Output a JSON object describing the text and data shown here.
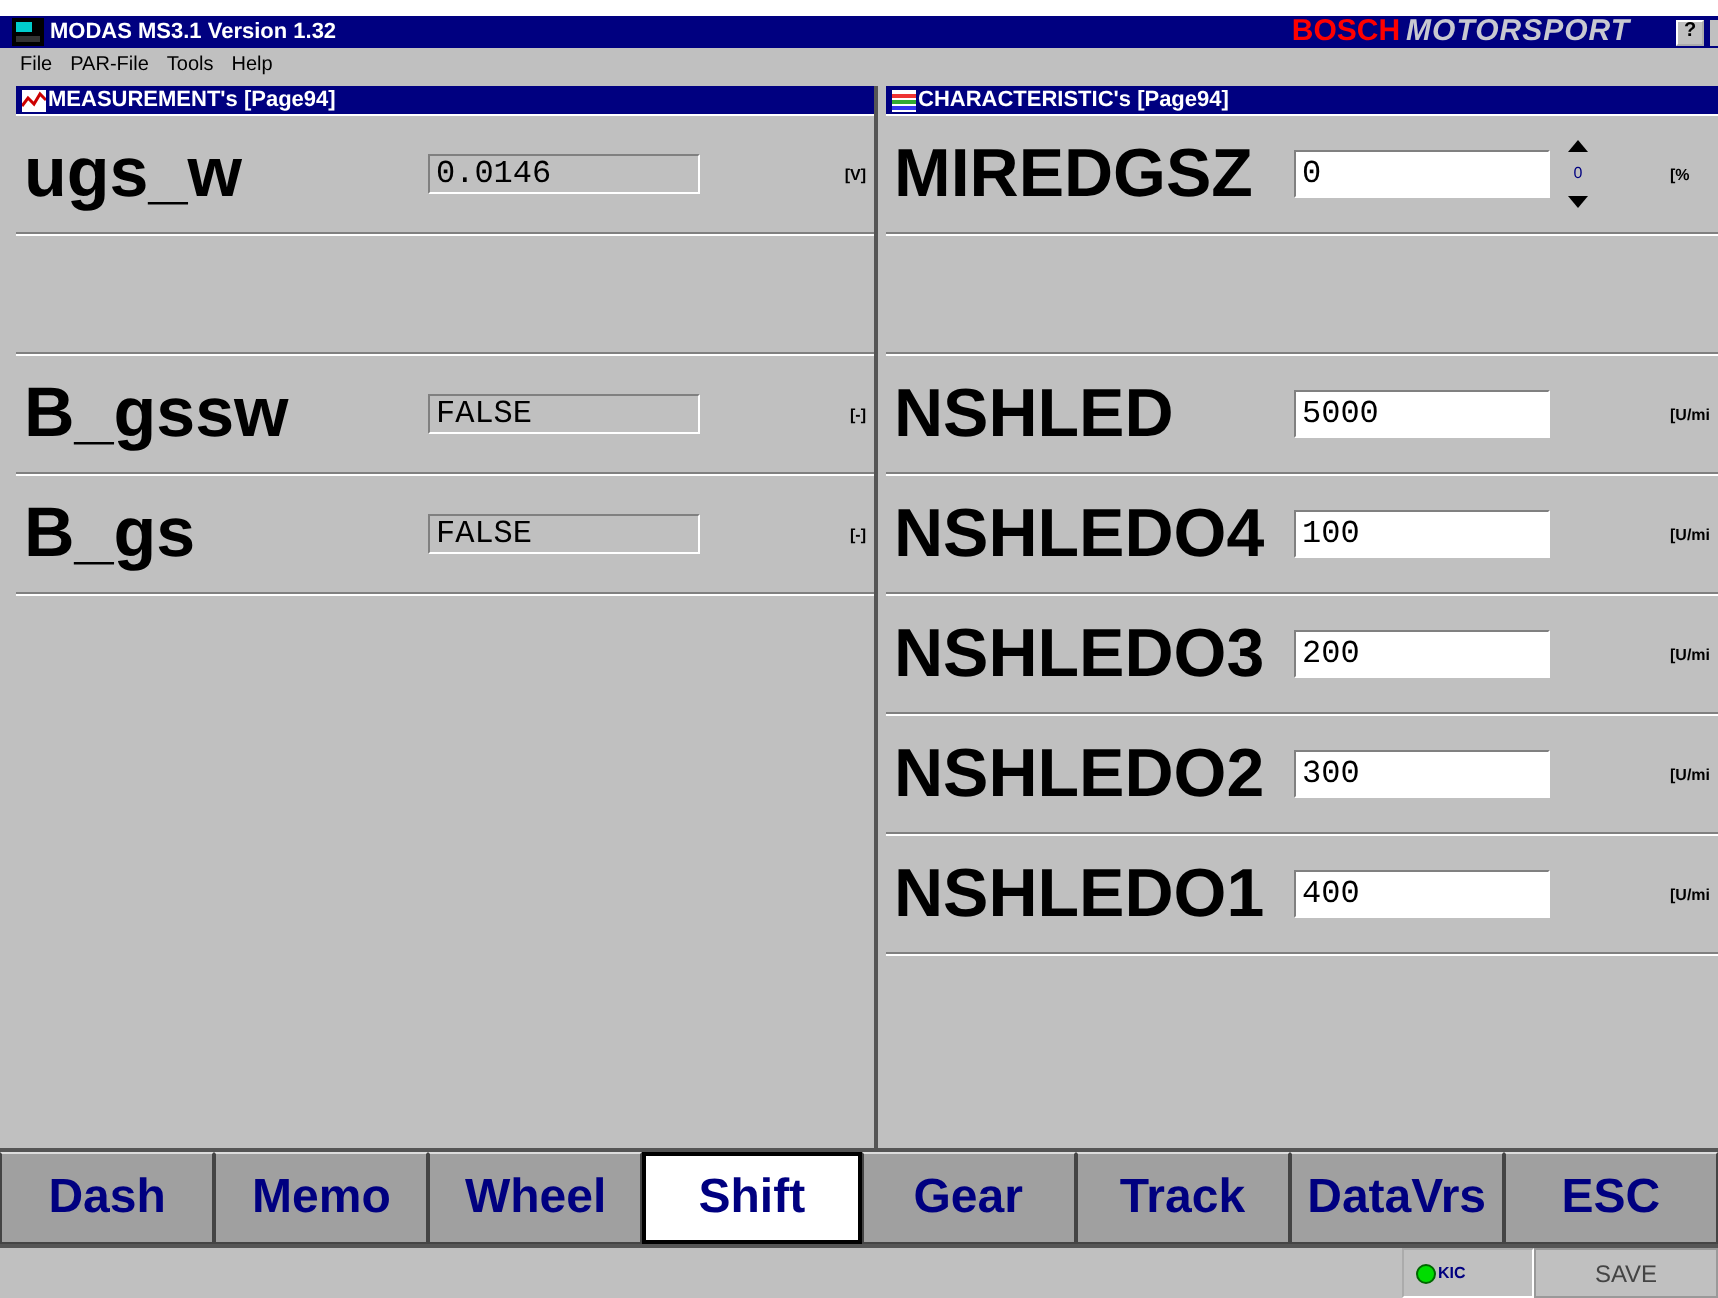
{
  "window": {
    "title": "MODAS MS3.1 Version 1.32",
    "brand_red": "BOSCH",
    "brand_italic": "MOTORSPORT",
    "help_button": "?"
  },
  "menu": [
    "File",
    "PAR-File",
    "Tools",
    "Help"
  ],
  "measurements": {
    "title": "MEASUREMENT's [Page94]",
    "rows": [
      {
        "kind": "value",
        "name": "ugs_w",
        "value": "0.0146",
        "unit": "[V]"
      },
      {
        "kind": "empty"
      },
      {
        "kind": "value",
        "name": "B_gssw",
        "value": "FALSE",
        "unit": "[-]"
      },
      {
        "kind": "value",
        "name": "B_gs",
        "value": "FALSE",
        "unit": "[-]"
      }
    ]
  },
  "characteristics": {
    "title": "CHARACTERISTIC's [Page94]",
    "rows": [
      {
        "kind": "spin",
        "name": "MIREDGSZ",
        "value": "0",
        "step": "0",
        "unit": "[%"
      },
      {
        "kind": "empty"
      },
      {
        "kind": "value",
        "name": "NSHLED",
        "value": "5000",
        "unit": "[U/mi"
      },
      {
        "kind": "value",
        "name": "NSHLEDO4",
        "value": "100",
        "unit": "[U/mi"
      },
      {
        "kind": "value",
        "name": "NSHLEDO3",
        "value": "200",
        "unit": "[U/mi"
      },
      {
        "kind": "value",
        "name": "NSHLEDO2",
        "value": "300",
        "unit": "[U/mi"
      },
      {
        "kind": "value",
        "name": "NSHLEDO1",
        "value": "400",
        "unit": "[U/mi"
      }
    ]
  },
  "tabs": [
    {
      "label": "Dash",
      "selected": false
    },
    {
      "label": "Memo",
      "selected": false
    },
    {
      "label": "Wheel",
      "selected": false
    },
    {
      "label": "Shift",
      "selected": true
    },
    {
      "label": "Gear",
      "selected": false
    },
    {
      "label": "Track",
      "selected": false
    },
    {
      "label": "DataVrs",
      "selected": false
    },
    {
      "label": "ESC",
      "selected": false
    }
  ],
  "status_bar": {
    "indicator": {
      "label": "KIC",
      "on": true
    },
    "save_button": "SAVE"
  }
}
